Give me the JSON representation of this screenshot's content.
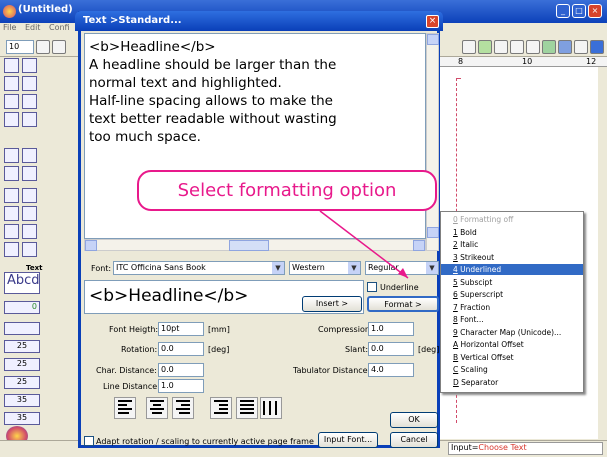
{
  "app": {
    "title": "(Untitled)",
    "menu": [
      "File",
      "Edit",
      "Confi"
    ],
    "zoom": "10",
    "status_label": "Input=",
    "status_value": "Choose Text",
    "palette_text_label": "Text",
    "palette_abcd": "Abcd",
    "palette_values": [
      "0",
      "25",
      "25",
      "25",
      "35",
      "35"
    ],
    "ruler_ticks": [
      "8",
      "10",
      "12"
    ]
  },
  "dialog": {
    "title": "Text >Standard...",
    "close": "×",
    "editor_text": "<b>Headline</b>\nA headline should be larger than the\nnormal text and highlighted.\nHalf-line spacing allows to make the\ntext better readable without wasting\ntoo much space.",
    "font_label": "Font:",
    "font_value": "ITC Officina Sans Book",
    "script_value": "Western",
    "style_value": "Regular",
    "preview_text": "<b>Headline</b>",
    "underline_label": "Underline",
    "insert_label": "Insert >",
    "format_label": "Format >",
    "font_height_label": "Font Heigth:",
    "font_height_value": "10pt",
    "font_height_unit": "[mm]",
    "rotation_label": "Rotation:",
    "rotation_value": "0.0",
    "rotation_unit": "[deg]",
    "char_distance_label": "Char. Distance:",
    "char_distance_value": "0.0",
    "line_distance_label": "Line Distance:",
    "line_distance_value": "1.0",
    "compression_label": "Compression:",
    "compression_value": "1.0",
    "slant_label": "Slant:",
    "slant_value": "0.0",
    "slant_unit": "[deg]",
    "tab_distance_label": "Tabulator Distance:",
    "tab_distance_value": "4.0",
    "ok_label": "OK",
    "adapt_label": "Adapt rotation / scaling to currently active page frame",
    "input_font_label": "Input Font...",
    "cancel_label": "Cancel"
  },
  "callout": "Select formatting option",
  "format_menu": [
    {
      "key": "0",
      "label": "Formatting off",
      "state": "disabled"
    },
    {
      "key": "1",
      "label": "Bold",
      "state": "normal"
    },
    {
      "key": "2",
      "label": "Italic",
      "state": "normal"
    },
    {
      "key": "3",
      "label": "Strikeout",
      "state": "normal"
    },
    {
      "key": "4",
      "label": "Underlined",
      "state": "selected"
    },
    {
      "key": "5",
      "label": "Subscipt",
      "state": "normal"
    },
    {
      "key": "6",
      "label": "Superscript",
      "state": "normal"
    },
    {
      "key": "7",
      "label": "Fraction",
      "state": "normal"
    },
    {
      "key": "8",
      "label": "Font...",
      "state": "normal"
    },
    {
      "key": "9",
      "label": "Character Map (Unicode)...",
      "state": "normal"
    },
    {
      "key": "A",
      "label": "Horizontal Offset",
      "state": "normal"
    },
    {
      "key": "B",
      "label": "Vertical Offset",
      "state": "normal"
    },
    {
      "key": "C",
      "label": "Scaling",
      "state": "normal"
    },
    {
      "key": "D",
      "label": "Separator",
      "state": "normal"
    }
  ],
  "colors": {
    "accent": "#e8198b",
    "selection": "#316ac5",
    "titlebar": "#0a3fb8"
  }
}
